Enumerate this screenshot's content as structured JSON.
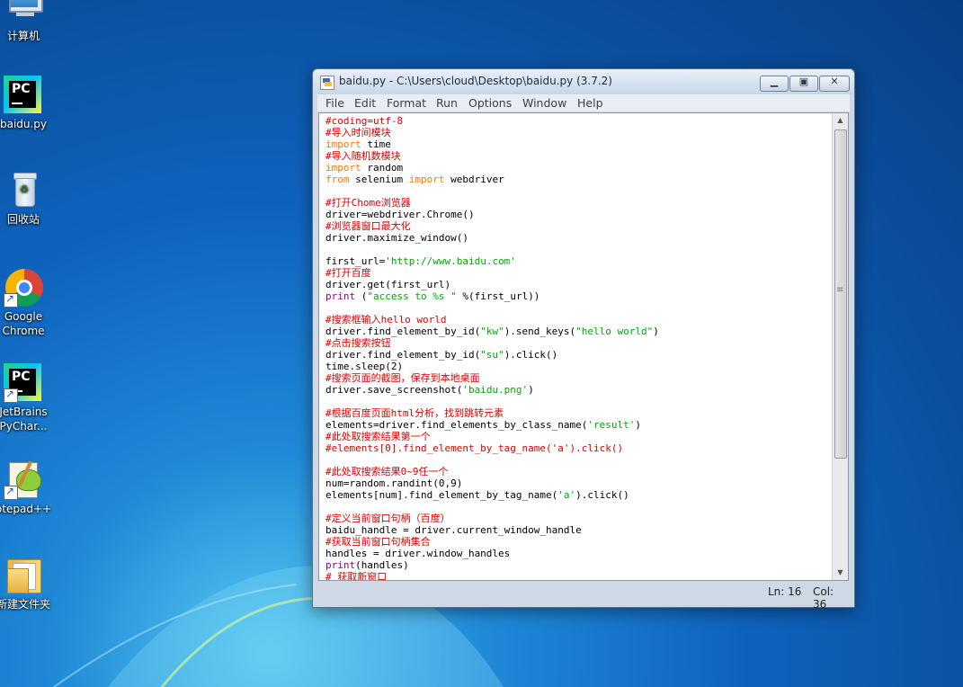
{
  "desktop": {
    "icons": [
      {
        "label": "计算机",
        "icon": "computer-icon"
      },
      {
        "label": "baidu.py",
        "icon": "pycharm-file-icon"
      },
      {
        "label": "回收站",
        "icon": "recycle-bin-icon"
      },
      {
        "label": "Google Chrome",
        "icon": "chrome-icon"
      },
      {
        "label": "JetBrains PyChar...",
        "icon": "pycharm-icon"
      },
      {
        "label": "otepad++",
        "icon": "notepad-plus-plus-icon"
      },
      {
        "label": "新建文件夹",
        "icon": "folder-icon"
      }
    ]
  },
  "window": {
    "title": "baidu.py - C:\\Users\\cloud\\Desktop\\baidu.py (3.7.2)",
    "menu": [
      "File",
      "Edit",
      "Format",
      "Run",
      "Options",
      "Window",
      "Help"
    ],
    "status": {
      "ln": "Ln: 16",
      "col": "Col: 36"
    }
  },
  "editor": {
    "lines": [
      [
        [
          "c",
          "#coding=utf-8"
        ]
      ],
      [
        [
          "c",
          "#导入时间模块"
        ]
      ],
      [
        [
          "k",
          "import"
        ],
        [
          "t",
          " time"
        ]
      ],
      [
        [
          "c",
          "#导入随机数模块"
        ]
      ],
      [
        [
          "k",
          "import"
        ],
        [
          "t",
          " random"
        ]
      ],
      [
        [
          "k",
          "from"
        ],
        [
          "t",
          " selenium "
        ],
        [
          "k",
          "import"
        ],
        [
          "t",
          " webdriver"
        ]
      ],
      [],
      [
        [
          "c",
          "#打开Chome浏览器"
        ]
      ],
      [
        [
          "t",
          "driver=webdriver.Chrome()"
        ]
      ],
      [
        [
          "c",
          "#浏览器窗口最大化"
        ]
      ],
      [
        [
          "t",
          "driver.maximize_window()"
        ]
      ],
      [],
      [
        [
          "t",
          "first_url="
        ],
        [
          "s",
          "'http://www.baidu.com'"
        ]
      ],
      [
        [
          "c",
          "#打开百度"
        ]
      ],
      [
        [
          "t",
          "driver.get(first_url)"
        ]
      ],
      [
        [
          "b",
          "print"
        ],
        [
          "t",
          " ("
        ],
        [
          "s",
          "\"access to %s \""
        ],
        [
          "t",
          " %(first_url))"
        ]
      ],
      [],
      [
        [
          "c",
          "#搜索框输入hello world"
        ]
      ],
      [
        [
          "t",
          "driver.find_element_by_id("
        ],
        [
          "s",
          "\"kw\""
        ],
        [
          "t",
          ").send_keys("
        ],
        [
          "s",
          "\"hello world\""
        ],
        [
          "t",
          ")"
        ]
      ],
      [
        [
          "c",
          "#点击搜索按钮"
        ]
      ],
      [
        [
          "t",
          "driver.find_element_by_id("
        ],
        [
          "s",
          "\"su\""
        ],
        [
          "t",
          ").click()"
        ]
      ],
      [
        [
          "t",
          "time.sleep(2)"
        ]
      ],
      [
        [
          "c",
          "#搜索页面的截图，保存到本地桌面"
        ]
      ],
      [
        [
          "t",
          "driver.save_screenshot("
        ],
        [
          "s",
          "'baidu.png'"
        ],
        [
          "t",
          ")"
        ]
      ],
      [],
      [
        [
          "c",
          "#根据百度页面html分析，找到跳转元素"
        ]
      ],
      [
        [
          "t",
          "elements=driver.find_elements_by_class_name("
        ],
        [
          "s",
          "'result'"
        ],
        [
          "t",
          ")"
        ]
      ],
      [
        [
          "c",
          "#此处取搜索结果第一个"
        ]
      ],
      [
        [
          "c",
          "#elements[0].find_element_by_tag_name('a').click()"
        ]
      ],
      [],
      [
        [
          "c",
          "#此处取搜索结果0~9任一个"
        ]
      ],
      [
        [
          "t",
          "num=random.randint(0,9)"
        ]
      ],
      [
        [
          "t",
          "elements[num].find_element_by_tag_name("
        ],
        [
          "s",
          "'a'"
        ],
        [
          "t",
          ").click()"
        ]
      ],
      [],
      [
        [
          "c",
          "#定义当前窗口句柄（百度）"
        ]
      ],
      [
        [
          "t",
          "baidu_handle = driver.current_window_handle"
        ]
      ],
      [
        [
          "c",
          "#获取当前窗口句柄集合"
        ]
      ],
      [
        [
          "t",
          "handles = driver.window_handles"
        ]
      ],
      [
        [
          "b",
          "print"
        ],
        [
          "t",
          "(handles)"
        ]
      ],
      [
        [
          "c",
          "# 获取新窗口"
        ]
      ]
    ]
  }
}
